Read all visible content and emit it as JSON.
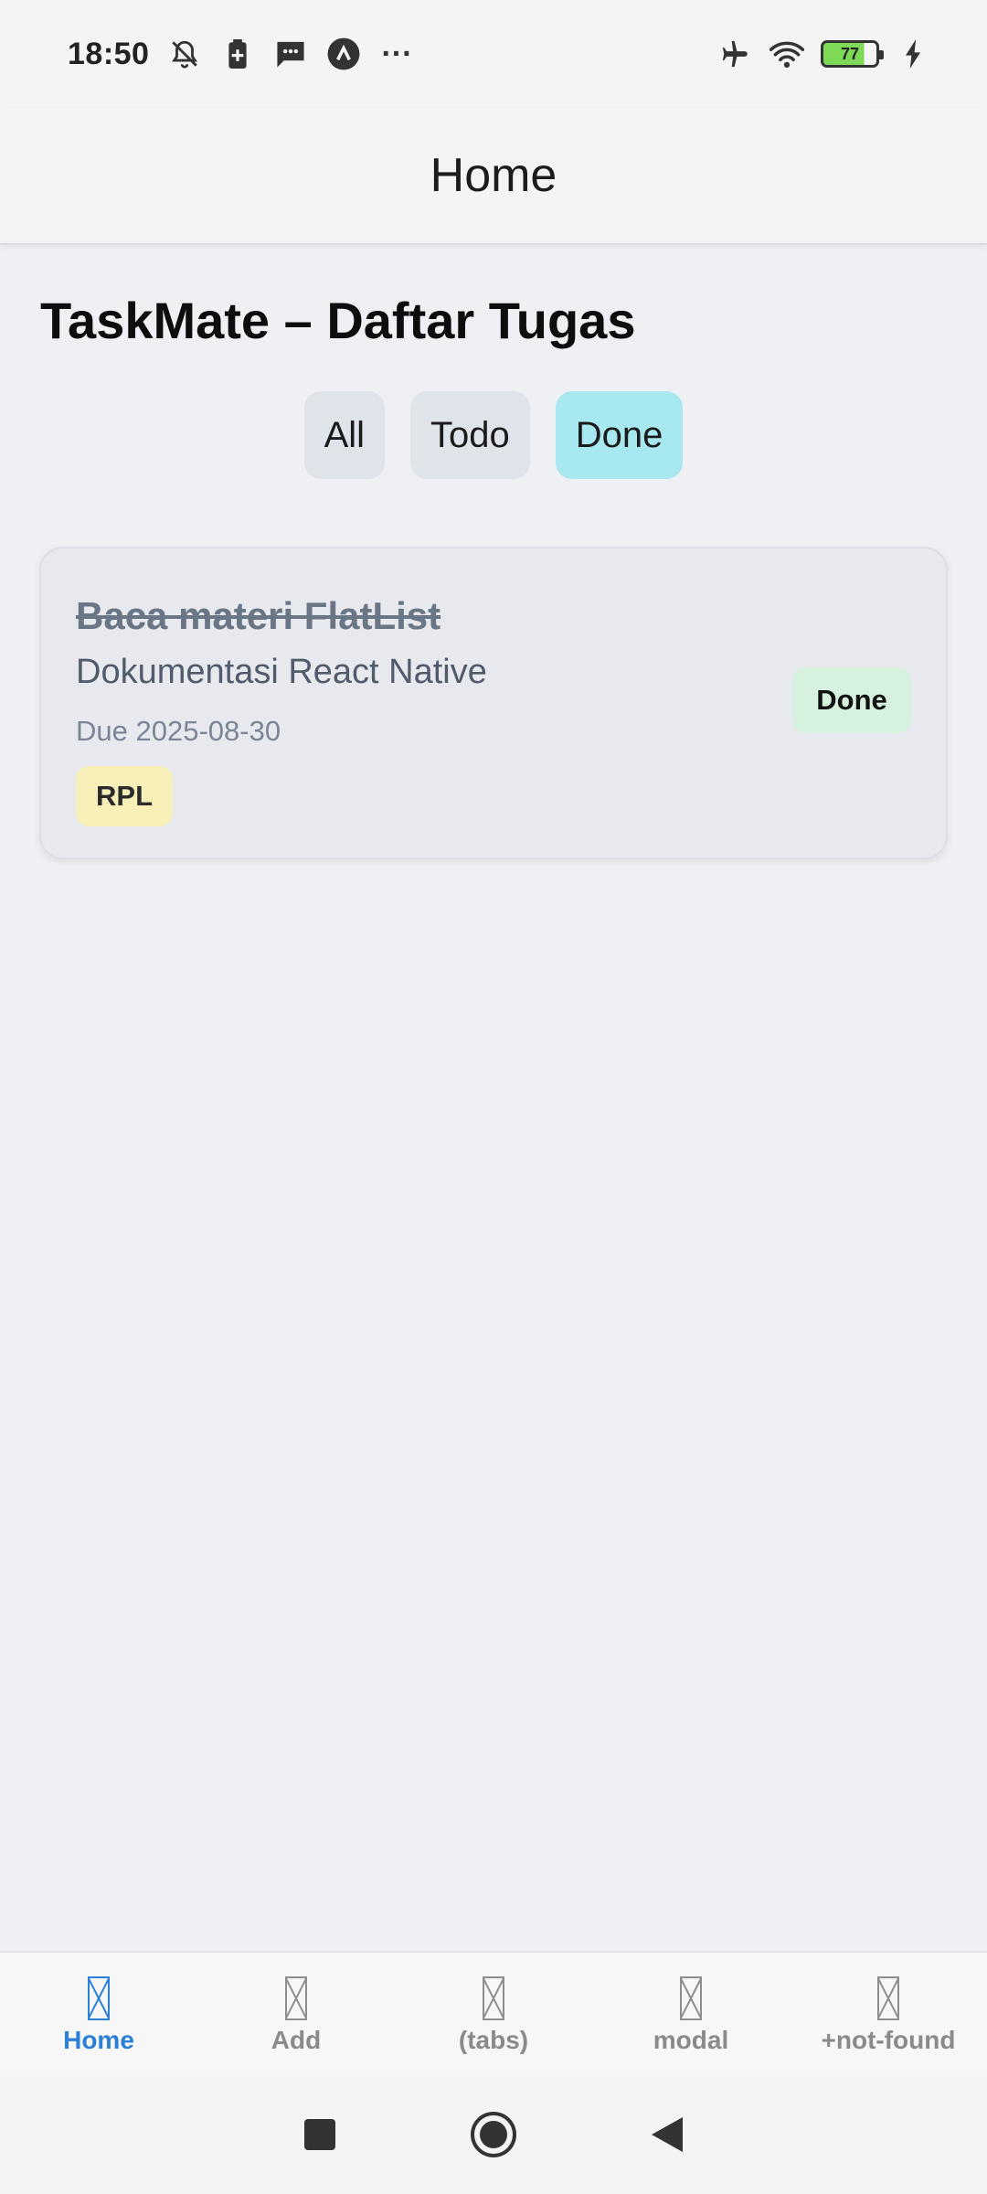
{
  "status_bar": {
    "time": "18:50",
    "battery_level": "77",
    "more": "···"
  },
  "header": {
    "title": "Home"
  },
  "main": {
    "title": "TaskMate – Daftar Tugas",
    "filters": [
      {
        "label": "All",
        "active": false
      },
      {
        "label": "Todo",
        "active": false
      },
      {
        "label": "Done",
        "active": true
      }
    ],
    "tasks": [
      {
        "title": "Baca materi FlatList",
        "description": "Dokumentasi React Native",
        "due": "Due 2025-08-30",
        "tag": "RPL",
        "status": "Done"
      }
    ]
  },
  "tab_bar": {
    "tabs": [
      {
        "label": "Home",
        "active": true
      },
      {
        "label": "Add",
        "active": false
      },
      {
        "label": "(tabs)",
        "active": false
      },
      {
        "label": "modal",
        "active": false
      },
      {
        "label": "+not-found",
        "active": false
      }
    ]
  },
  "colors": {
    "accent": "#2a7fd6",
    "active_filter": "#a7e8f1",
    "status_done_bg": "#d6f1de",
    "tag_bg": "#f6efb8"
  }
}
